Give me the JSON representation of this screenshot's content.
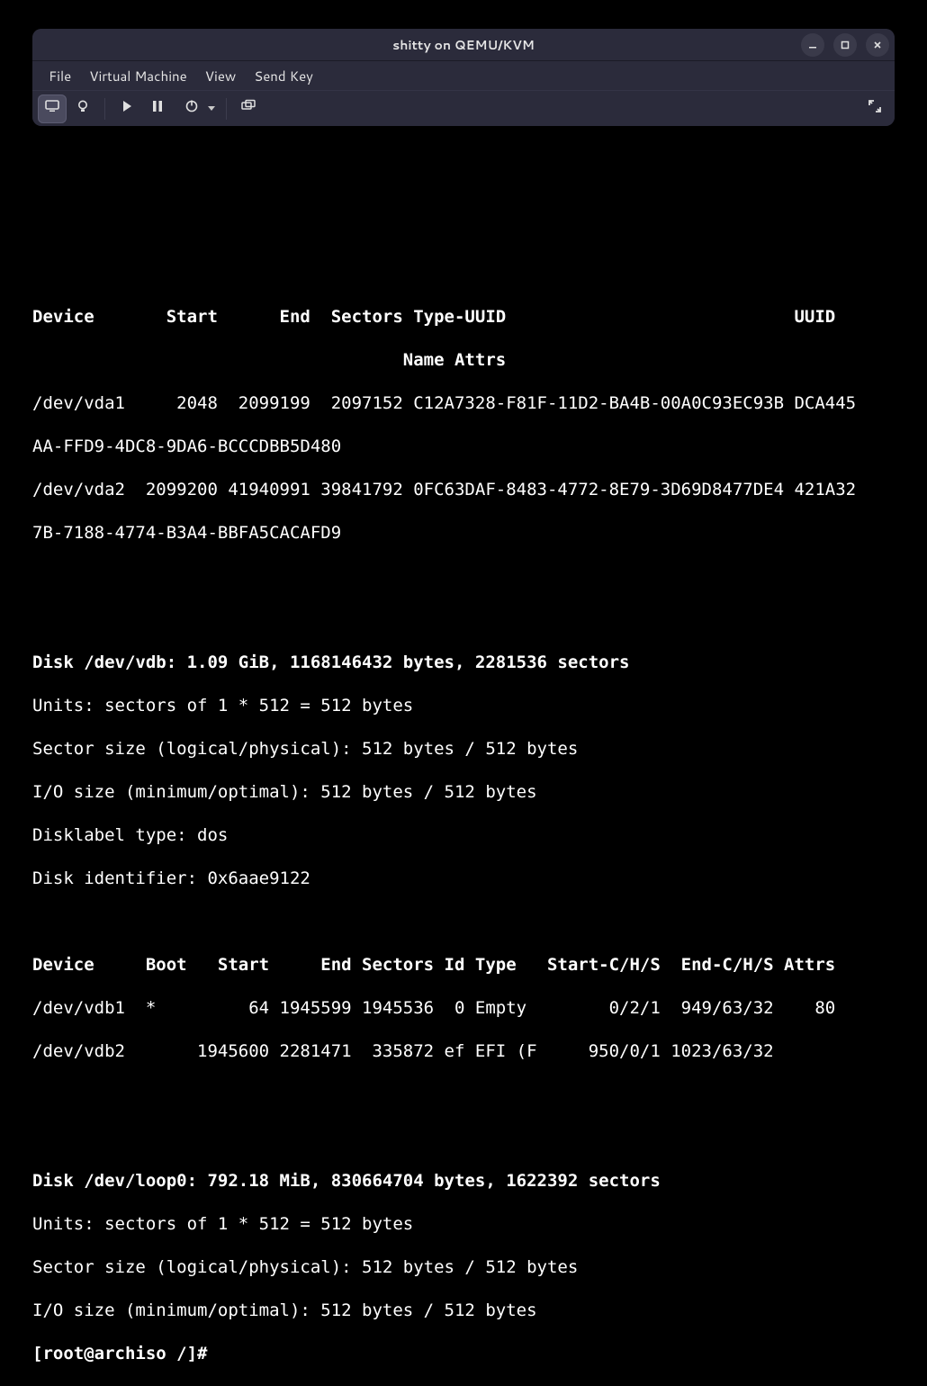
{
  "window": {
    "title": "shitty on QEMU/KVM"
  },
  "menu": {
    "file": "File",
    "vm": "Virtual Machine",
    "view": "View",
    "sendkey": "Send Key"
  },
  "term": {
    "vda_header": "Device       Start      End  Sectors Type-UUID                            UUID",
    "vda_header2": "                                    Name Attrs",
    "vda1": "/dev/vda1     2048  2099199  2097152 C12A7328-F81F-11D2-BA4B-00A0C93EC93B DCA445",
    "vda1b": "AA-FFD9-4DC8-9DA6-BCCCDBB5D480",
    "vda2": "/dev/vda2  2099200 41940991 39841792 0FC63DAF-8483-4772-8E79-3D69D8477DE4 421A32",
    "vda2b": "7B-7188-4774-B3A4-BBFA5CACAFD9",
    "vdb_disk": "Disk /dev/vdb: 1.09 GiB, 1168146432 bytes, 2281536 sectors",
    "vdb_units": "Units: sectors of 1 * 512 = 512 bytes",
    "vdb_sector": "Sector size (logical/physical): 512 bytes / 512 bytes",
    "vdb_io": "I/O size (minimum/optimal): 512 bytes / 512 bytes",
    "vdb_label": "Disklabel type: dos",
    "vdb_id": "Disk identifier: 0x6aae9122",
    "vdb_header": "Device     Boot   Start     End Sectors Id Type   Start-C/H/S  End-C/H/S Attrs",
    "vdb1": "/dev/vdb1  *         64 1945599 1945536  0 Empty        0/2/1  949/63/32    80",
    "vdb2": "/dev/vdb2       1945600 2281471  335872 ef EFI (F     950/0/1 1023/63/32",
    "loop_disk": "Disk /dev/loop0: 792.18 MiB, 830664704 bytes, 1622392 sectors",
    "loop_units": "Units: sectors of 1 * 512 = 512 bytes",
    "loop_sector": "Sector size (logical/physical): 512 bytes / 512 bytes",
    "loop_io": "I/O size (minimum/optimal): 512 bytes / 512 bytes",
    "prompt": "[root@archiso /]#"
  }
}
